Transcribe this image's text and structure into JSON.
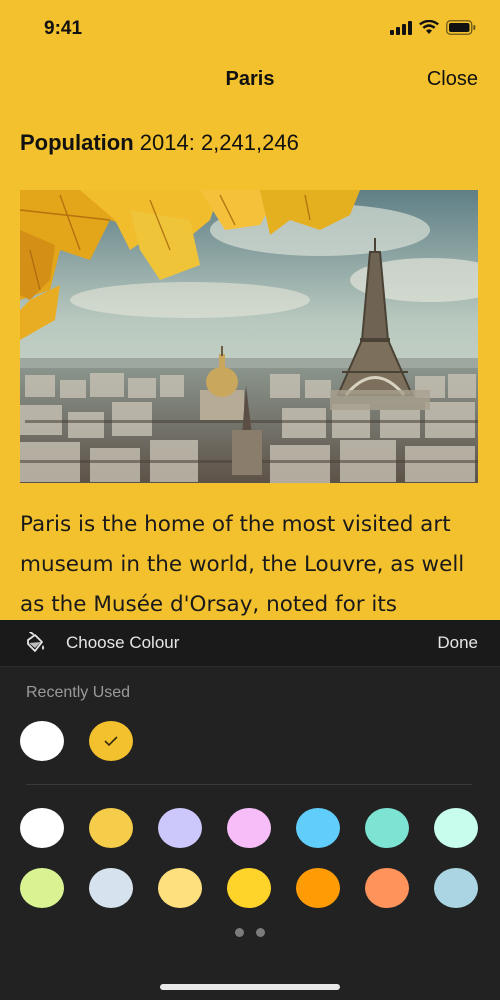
{
  "status_bar": {
    "time": "9:41"
  },
  "nav": {
    "title": "Paris",
    "close_label": "Close"
  },
  "content": {
    "population_label": "Population",
    "population_value": "2014: 2,241,246",
    "image_icon": "paris-city-photo",
    "body_text": "Paris is the home of the most visited art museum in the world, the Louvre, as well as the Musée d'Orsay, noted for its"
  },
  "colour_sheet": {
    "icon": "paint-bucket-icon",
    "title": "Choose Colour",
    "done_label": "Done",
    "recent_label": "Recently Used",
    "recent_colours": [
      {
        "color": "#ffffff",
        "selected": false
      },
      {
        "color": "#f3c12d",
        "selected": true
      }
    ],
    "palette_row_1": [
      "#ffffff",
      "#f5cd4a",
      "#ccc8fb",
      "#f6bdf8",
      "#60cdfb",
      "#7de4d4",
      "#c8fdee"
    ],
    "palette_row_2": [
      "#d9f392",
      "#d6e3ee",
      "#ffe07e",
      "#ffd42a",
      "#ff9c05",
      "#fe945c",
      "#abd5e3"
    ],
    "page_count": 2
  },
  "colors": {
    "background": "#f3c12d",
    "sheet": "#222222",
    "sheet_header": "#1a1a1a"
  }
}
